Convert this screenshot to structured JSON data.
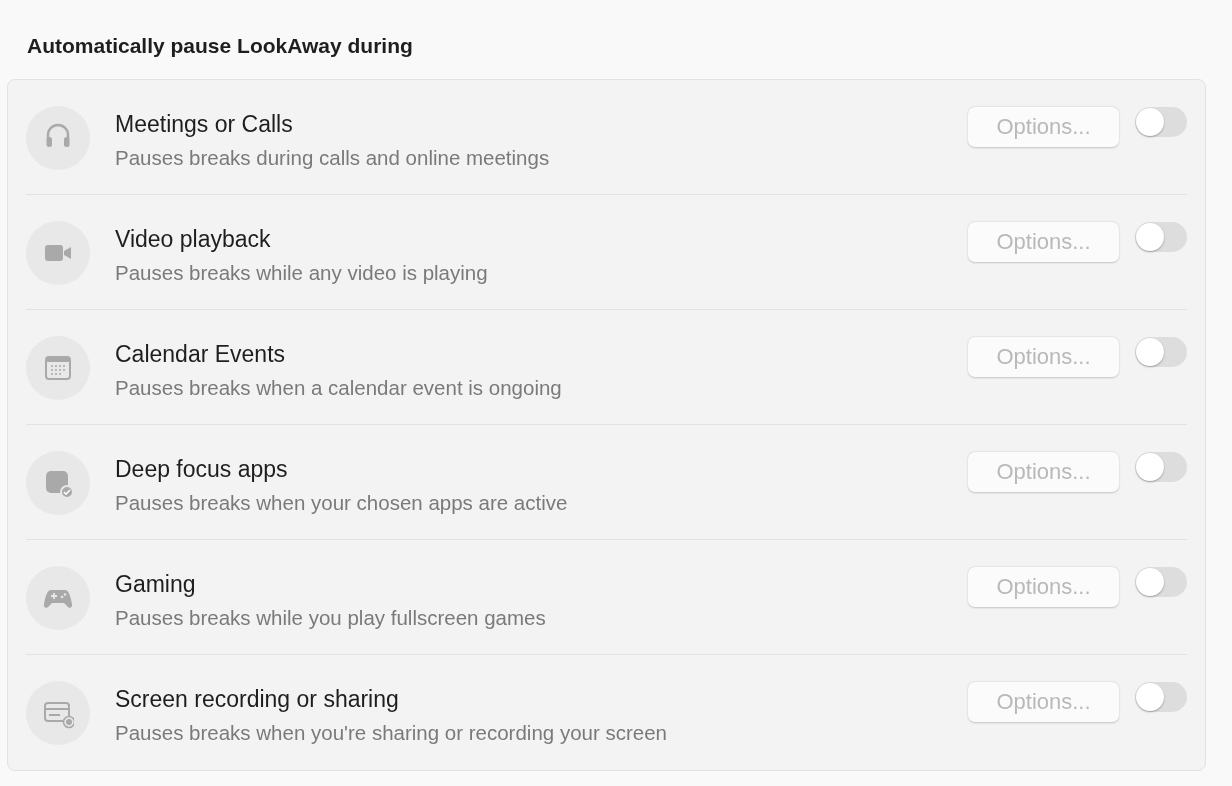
{
  "section": {
    "title": "Automatically pause LookAway during"
  },
  "rows": [
    {
      "title": "Meetings or Calls",
      "description": "Pauses breaks during calls and online meetings",
      "options": {
        "label": "Options...",
        "disabled": true
      },
      "on": false
    },
    {
      "title": "Video playback",
      "description": "Pauses breaks while any video is playing",
      "options": {
        "label": "Options...",
        "disabled": true
      },
      "on": false
    },
    {
      "title": "Calendar Events",
      "description": "Pauses breaks when a calendar event is ongoing",
      "options": {
        "label": "Options...",
        "disabled": true
      },
      "on": false
    },
    {
      "title": "Deep focus apps",
      "description": "Pauses breaks when your chosen apps are active",
      "options": {
        "label": "Options...",
        "disabled": true
      },
      "on": false
    },
    {
      "title": "Gaming",
      "description": "Pauses breaks while you play fullscreen games",
      "options": {
        "label": "Options...",
        "disabled": true
      },
      "on": false
    },
    {
      "title": "Screen recording or sharing",
      "description": "Pauses breaks when you're sharing or recording your screen",
      "options": {
        "label": "Options...",
        "disabled": true
      },
      "on": false
    }
  ]
}
